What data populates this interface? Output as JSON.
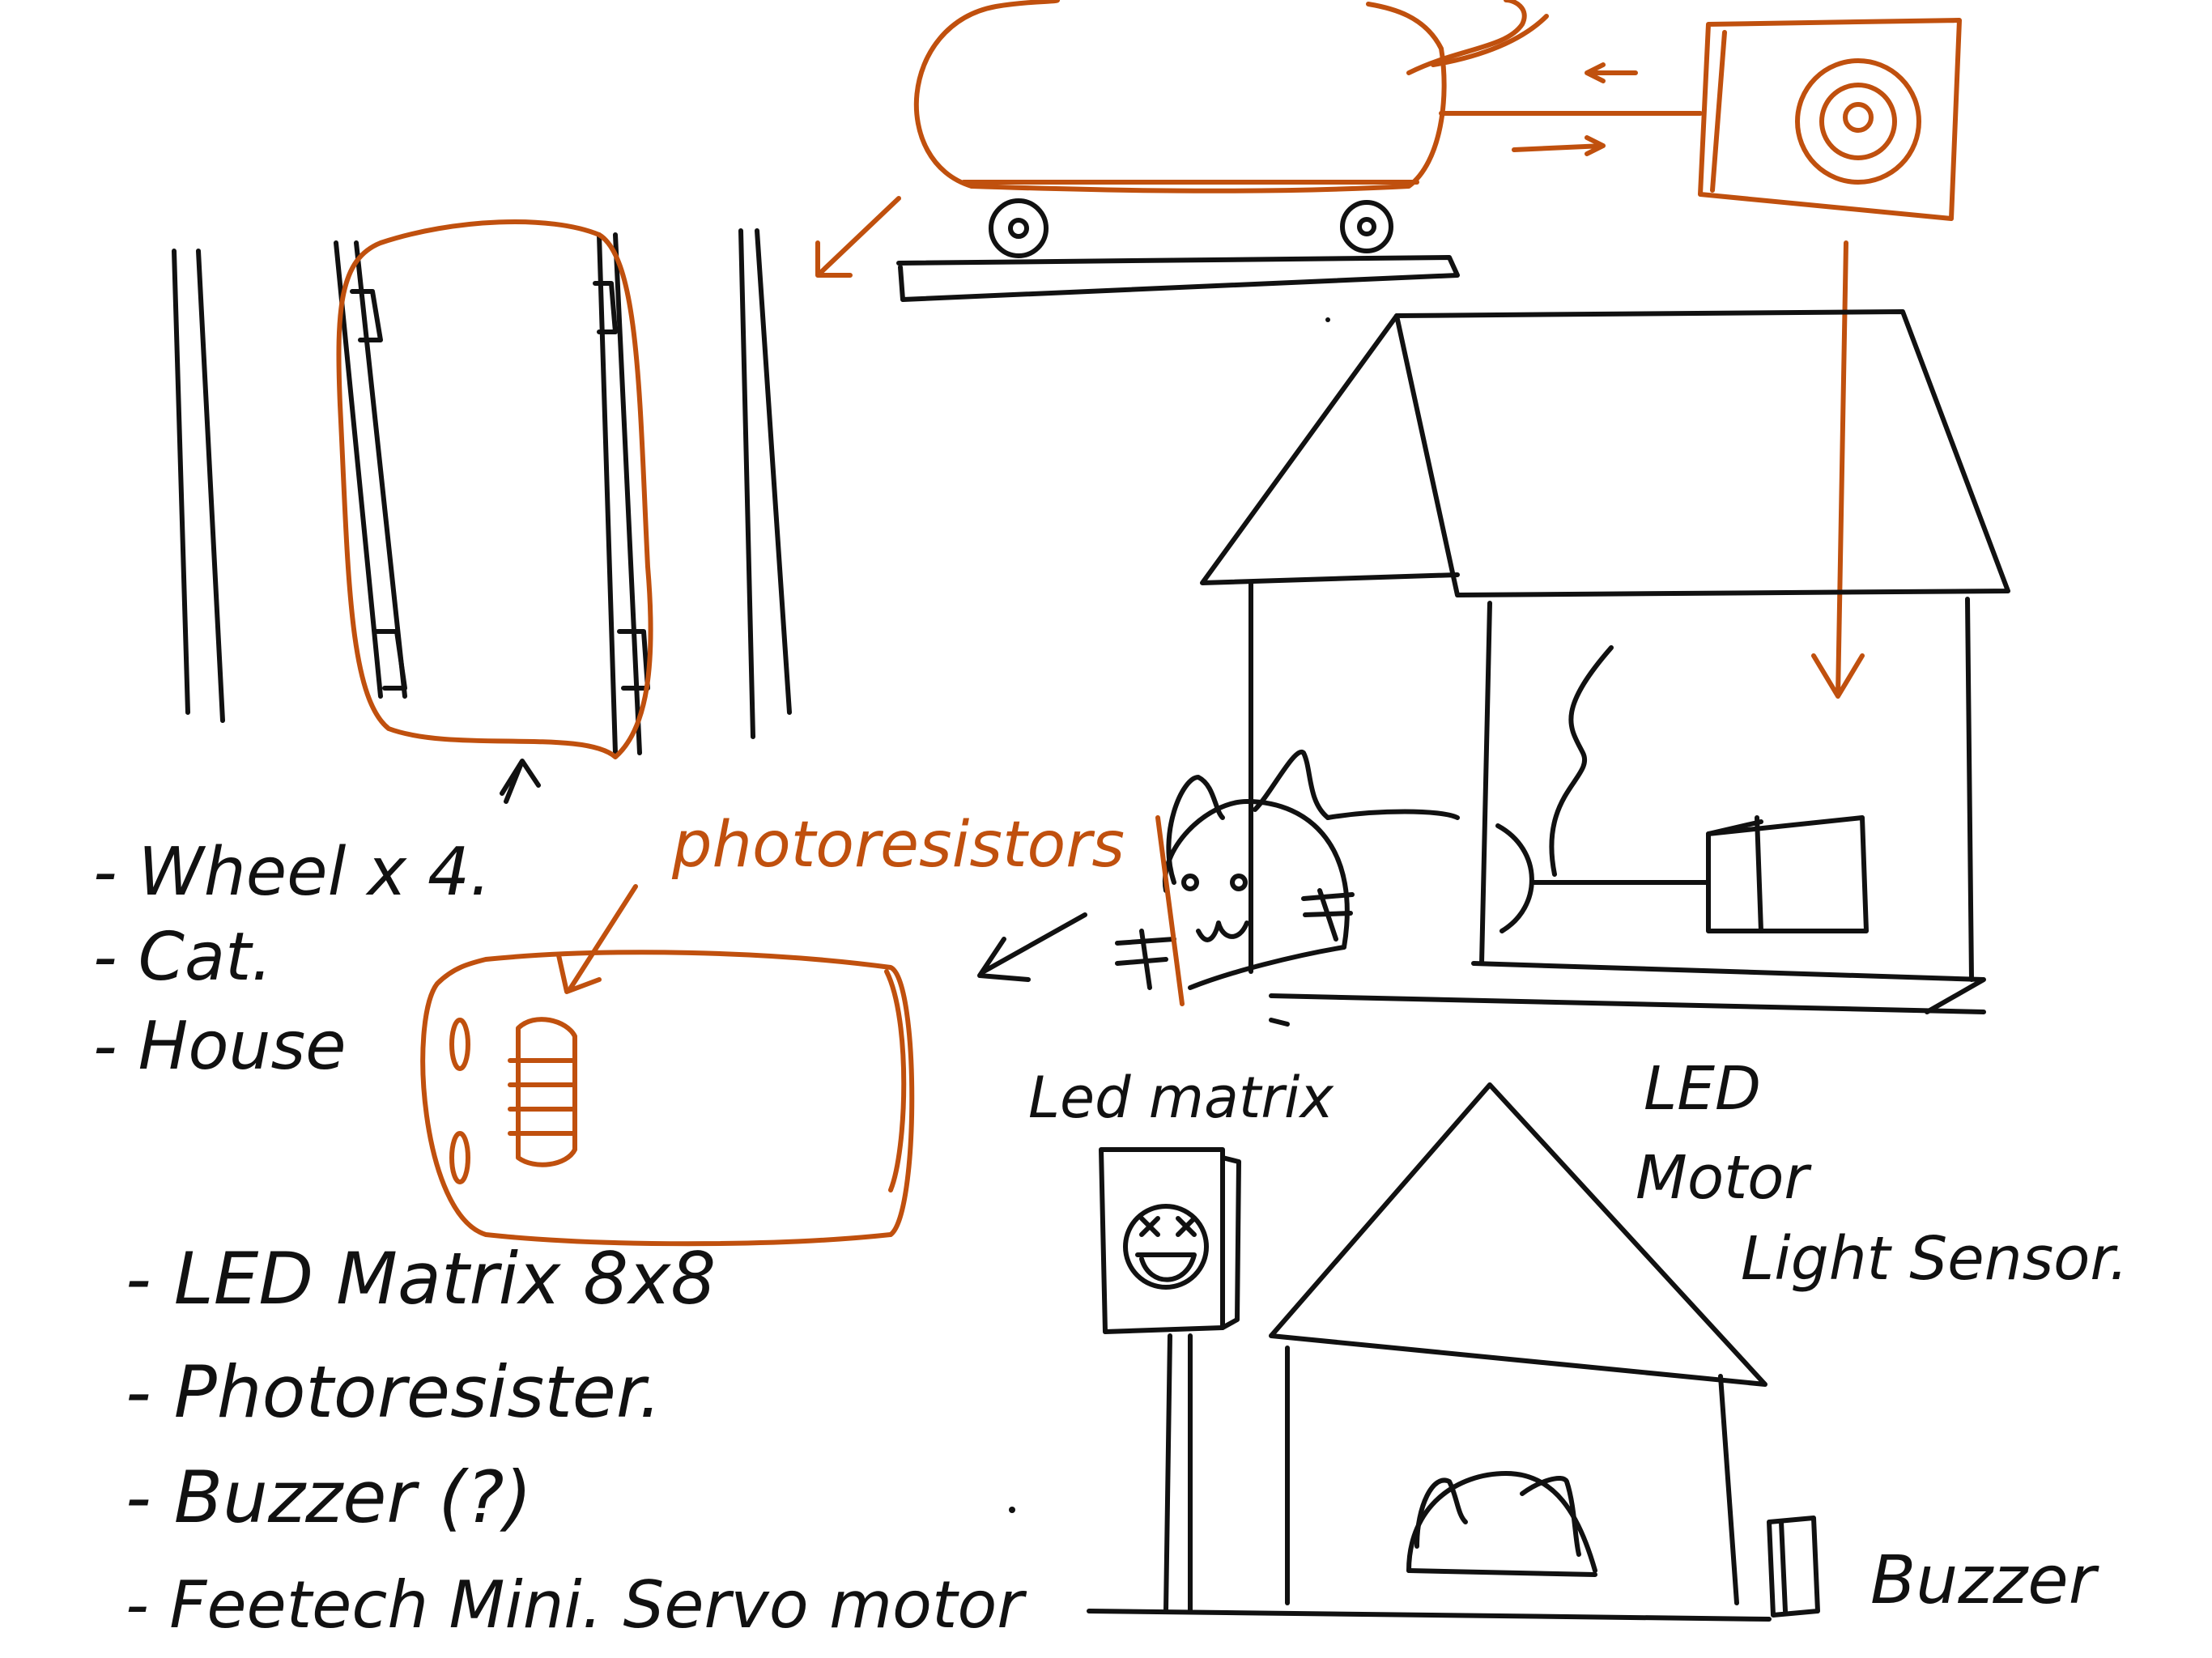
{
  "colors": {
    "ink": "#111111",
    "accent": "#c0500e",
    "background": "#ffffff"
  },
  "labels": {
    "photoresistors": "photoresistors",
    "led_matrix": "Led matrix",
    "led": "LED",
    "motor": "Motor",
    "light_sensor": "Light Sensor.",
    "buzzer": "Buzzer"
  },
  "parts_list_1": [
    "- Wheel x 4.",
    "- Cat.",
    "- House"
  ],
  "parts_list_2": [
    "- LED Matrix 8x8",
    "- Photoresister.",
    "- Buzzer (?)",
    "- Feetech Mini. Servo motor"
  ]
}
